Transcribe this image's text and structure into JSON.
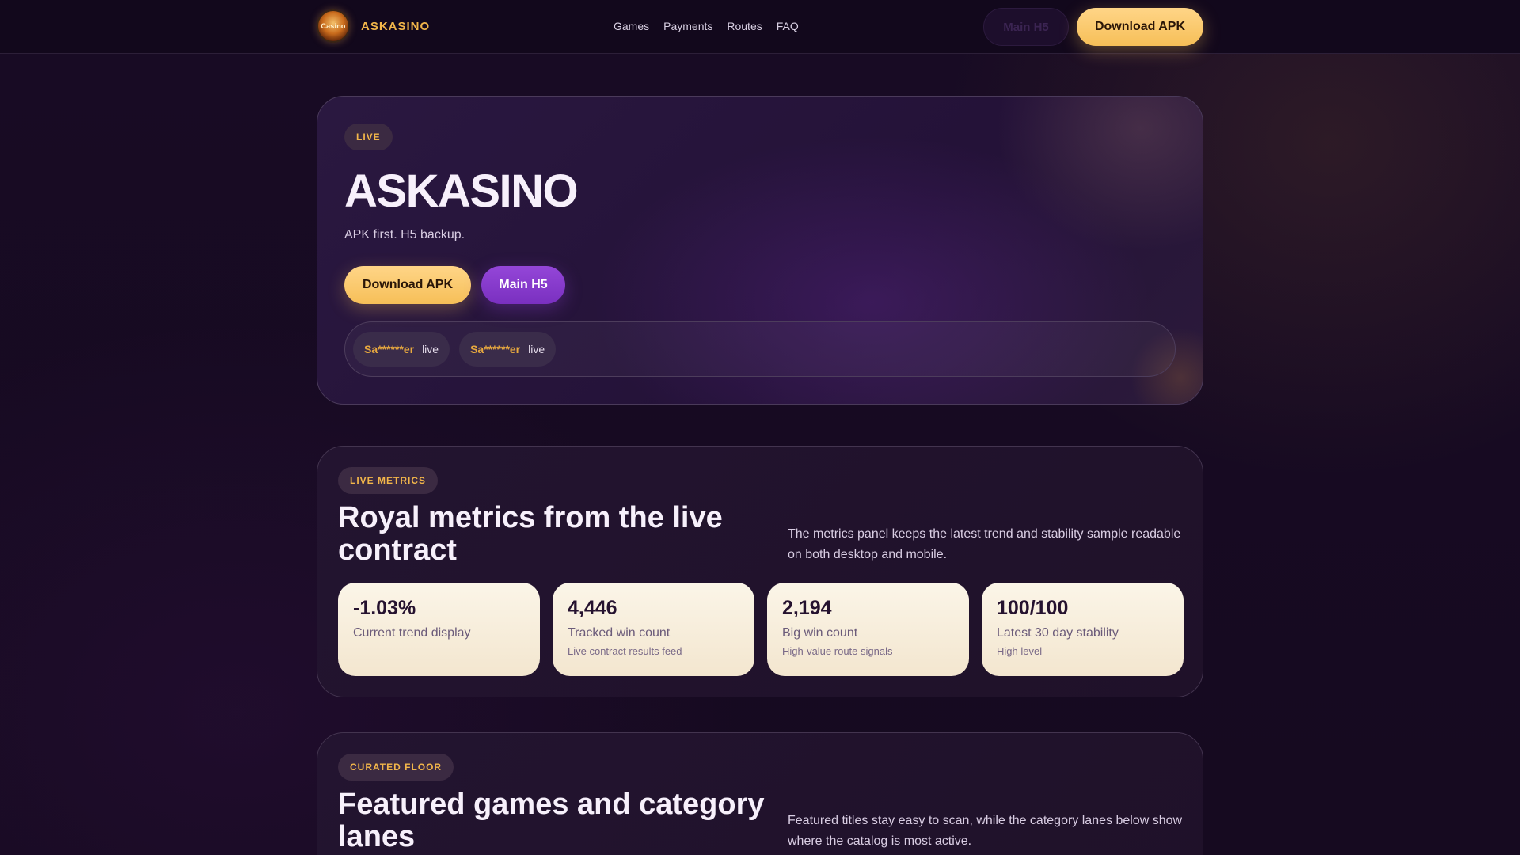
{
  "header": {
    "brand_name": "ASKASINO",
    "logo_text": "Casino",
    "nav": [
      "Games",
      "Payments",
      "Routes",
      "FAQ"
    ],
    "btn_h5": "Main H5",
    "btn_apk": "Download APK"
  },
  "hero": {
    "tag": "LIVE",
    "title": "ASKASINO",
    "subtitle": "APK first. H5 backup.",
    "btn_apk": "Download APK",
    "btn_h5": "Main H5",
    "ticker": [
      {
        "user": "Sa******er",
        "status": "live"
      },
      {
        "user": "Sa******er",
        "status": "live"
      }
    ]
  },
  "metrics": {
    "tag": "LIVE METRICS",
    "title": "Royal metrics from the live contract",
    "description": "The metrics panel keeps the latest trend and stability sample readable on both desktop and mobile.",
    "cards": [
      {
        "value": "-1.03%",
        "label": "Current trend display",
        "note": ""
      },
      {
        "value": "4,446",
        "label": "Tracked win count",
        "note": "Live contract results feed"
      },
      {
        "value": "2,194",
        "label": "Big win count",
        "note": "High-value route signals"
      },
      {
        "value": "100/100",
        "label": "Latest 30 day stability",
        "note": "High level"
      }
    ]
  },
  "games": {
    "tag": "CURATED FLOOR",
    "title": "Featured games and category lanes",
    "description": "Featured titles stay easy to scan, while the category lanes below show where the catalog is most active."
  },
  "colors": {
    "accent_gold": "#f6bf58",
    "accent_purple": "#8a3ed0",
    "background": "#170a22"
  }
}
